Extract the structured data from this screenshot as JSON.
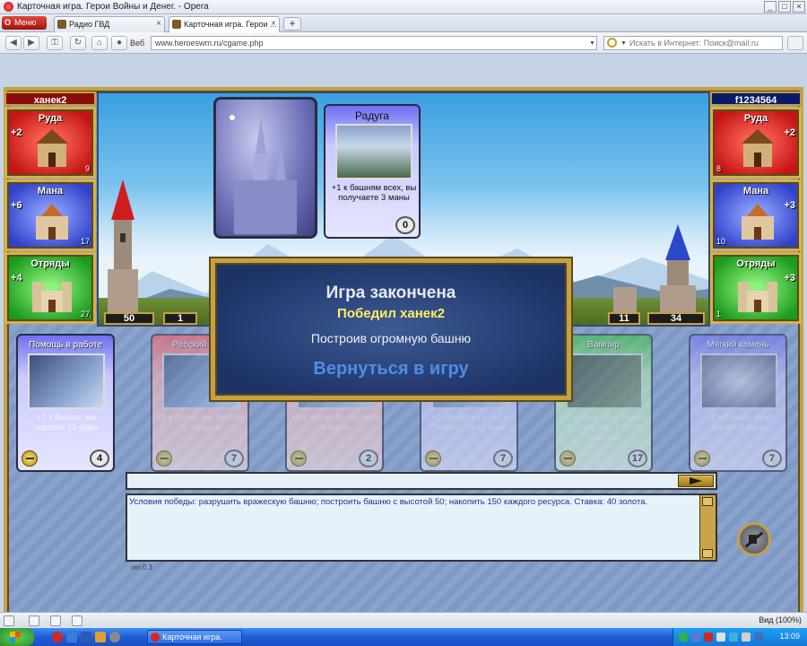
{
  "window": {
    "title": "Карточная игра. Герои Войны и Денег. - Opera"
  },
  "tabs": {
    "menu_label": "Меню",
    "items": [
      {
        "label": "Радио ГВД"
      },
      {
        "label": "Карточная игра. Герои ..."
      }
    ],
    "add_label": "+"
  },
  "addressbar": {
    "web_label": "Веб",
    "url": "www.heroeswm.ru/cgame.php",
    "search_placeholder": "Искать в Интернет: Поиск@mail.ru"
  },
  "players": {
    "left": {
      "name": "ханек2",
      "resources": [
        {
          "title": "Руда",
          "rate": "+2",
          "count": "9"
        },
        {
          "title": "Мана",
          "rate": "+6",
          "count": "17"
        },
        {
          "title": "Отряды",
          "rate": "+4",
          "count": "27"
        }
      ],
      "tower": "50",
      "wall": "1"
    },
    "right": {
      "name": "f1234564",
      "resources": [
        {
          "title": "Руда",
          "rate": "+2",
          "count": "8"
        },
        {
          "title": "Мана",
          "rate": "+3",
          "count": "10"
        },
        {
          "title": "Отряды",
          "rate": "+3",
          "count": "1"
        }
      ],
      "wall": "11",
      "tower": "34"
    }
  },
  "played_card": {
    "title": "Радуга",
    "desc": "+1 к башням всех, вы получаете 3 маны",
    "cost": "0"
  },
  "hand": [
    {
      "title": "Помощь в работе",
      "desc": "+7 к башне, вы теряете 10 руды",
      "cost": "4"
    },
    {
      "title": "Рабский труд",
      "desc": "+9 к стене, вы теряете 5 отрядов",
      "cost": "7"
    },
    {
      "title": "",
      "desc": "+5 к стене, вы теряете 6 маны",
      "cost": "2"
    },
    {
      "title": "",
      "desc": "+1 монастырь, +3 к башне, +3 к стене",
      "cost": "7"
    },
    {
      "title": "Вампир",
      "desc": "10 урона, враг теряет 5 отрядов, -1 к его казарме",
      "cost": "17"
    },
    {
      "title": "Мягкий камень",
      "desc": "+5 к башне, враг теряет 6 руды",
      "cost": "7"
    }
  ],
  "game_over": {
    "title": "Игра закончена",
    "winner": "Победил ханек2",
    "reason": "Построив огромную башню",
    "return_label": "Вернуться в игру"
  },
  "log": {
    "text": "Условия победы: разрушить вражескую башню; построить башню с высотой 50; накопить 150 каждого ресурса. Ставка: 40 золота.",
    "version": "ver.0.3"
  },
  "statusbar": {
    "zoom_label": "Вид (100%)"
  },
  "taskbar": {
    "task_label": "Карточная игра. Герои ...",
    "clock": "13:09"
  }
}
